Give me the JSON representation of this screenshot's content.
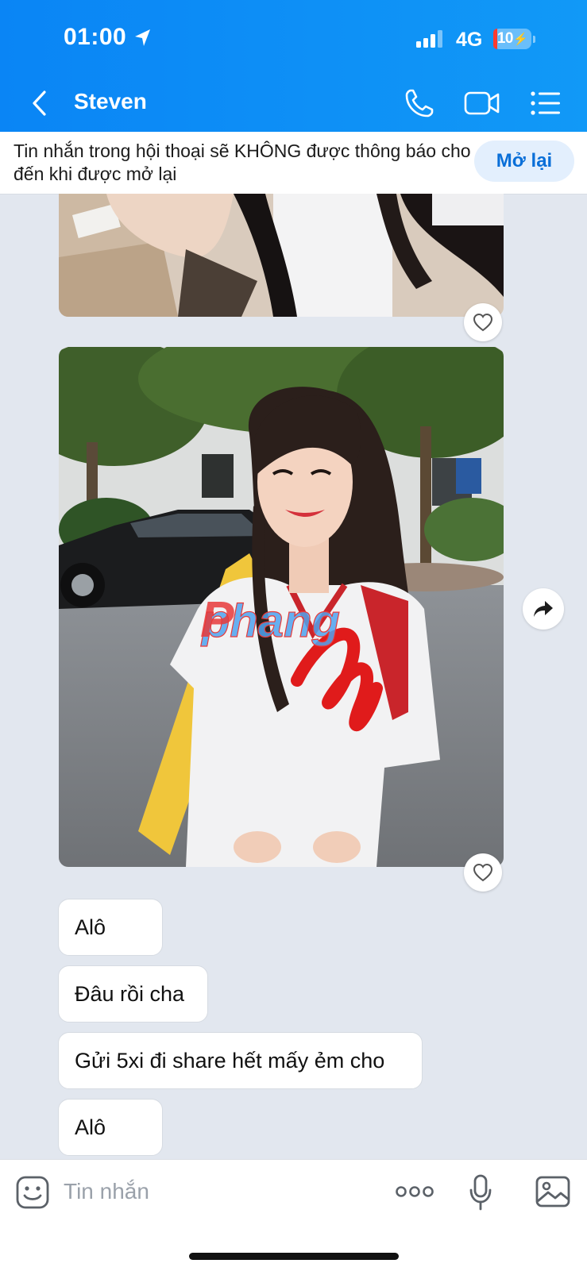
{
  "status_bar": {
    "time": "01:00",
    "network": "4G",
    "battery": "10"
  },
  "header": {
    "contact_name": "Steven",
    "icons": [
      "back-chevron-icon",
      "phone-icon",
      "video-camera-icon",
      "list-menu-icon"
    ]
  },
  "mute_banner": {
    "text": "Tin nhắn trong hội thoại sẽ KHÔNG được thông báo cho đến khi được mở lại",
    "action_label": "Mở lại"
  },
  "messages": [
    {
      "type": "image",
      "description_icon": "photo",
      "reaction_icon": "heart-icon"
    },
    {
      "type": "image",
      "description_icon": "photo",
      "reaction_icon": "heart-icon",
      "share_icon": "forward-arrow-icon",
      "watermark": "phang"
    },
    {
      "type": "text",
      "text": "Alô"
    },
    {
      "type": "text",
      "text": "Đâu rồi cha"
    },
    {
      "type": "text",
      "text": "Gửi 5xi đi share hết mấy ẻm cho"
    },
    {
      "type": "text",
      "text": "Alô"
    }
  ],
  "composer": {
    "placeholder": "Tin nhắn",
    "icons": [
      "sticker-emoji-icon",
      "more-dots-icon",
      "microphone-icon",
      "gallery-icon"
    ]
  },
  "colors": {
    "header_blue": "#0a85f5",
    "accent_blue": "#0a6fd8",
    "chat_background": "#e2e7ef"
  }
}
